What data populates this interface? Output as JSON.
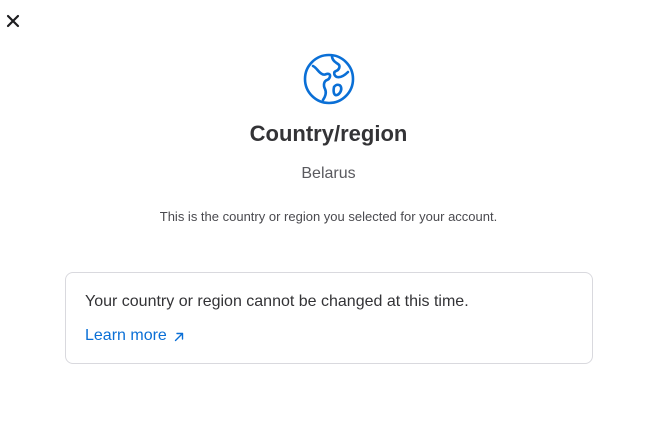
{
  "header": {
    "close_icon": "close-icon"
  },
  "main": {
    "icon": "globe-icon",
    "title": "Country/region",
    "country": "Belarus",
    "description": "This is the country or region you selected for your account."
  },
  "notice": {
    "message": "Your country or region cannot be changed at this time.",
    "link_label": "Learn more",
    "link_icon": "external-arrow-icon"
  },
  "colors": {
    "accent": "#0a6fd6",
    "text": "#333336",
    "border": "#d9d9de"
  }
}
